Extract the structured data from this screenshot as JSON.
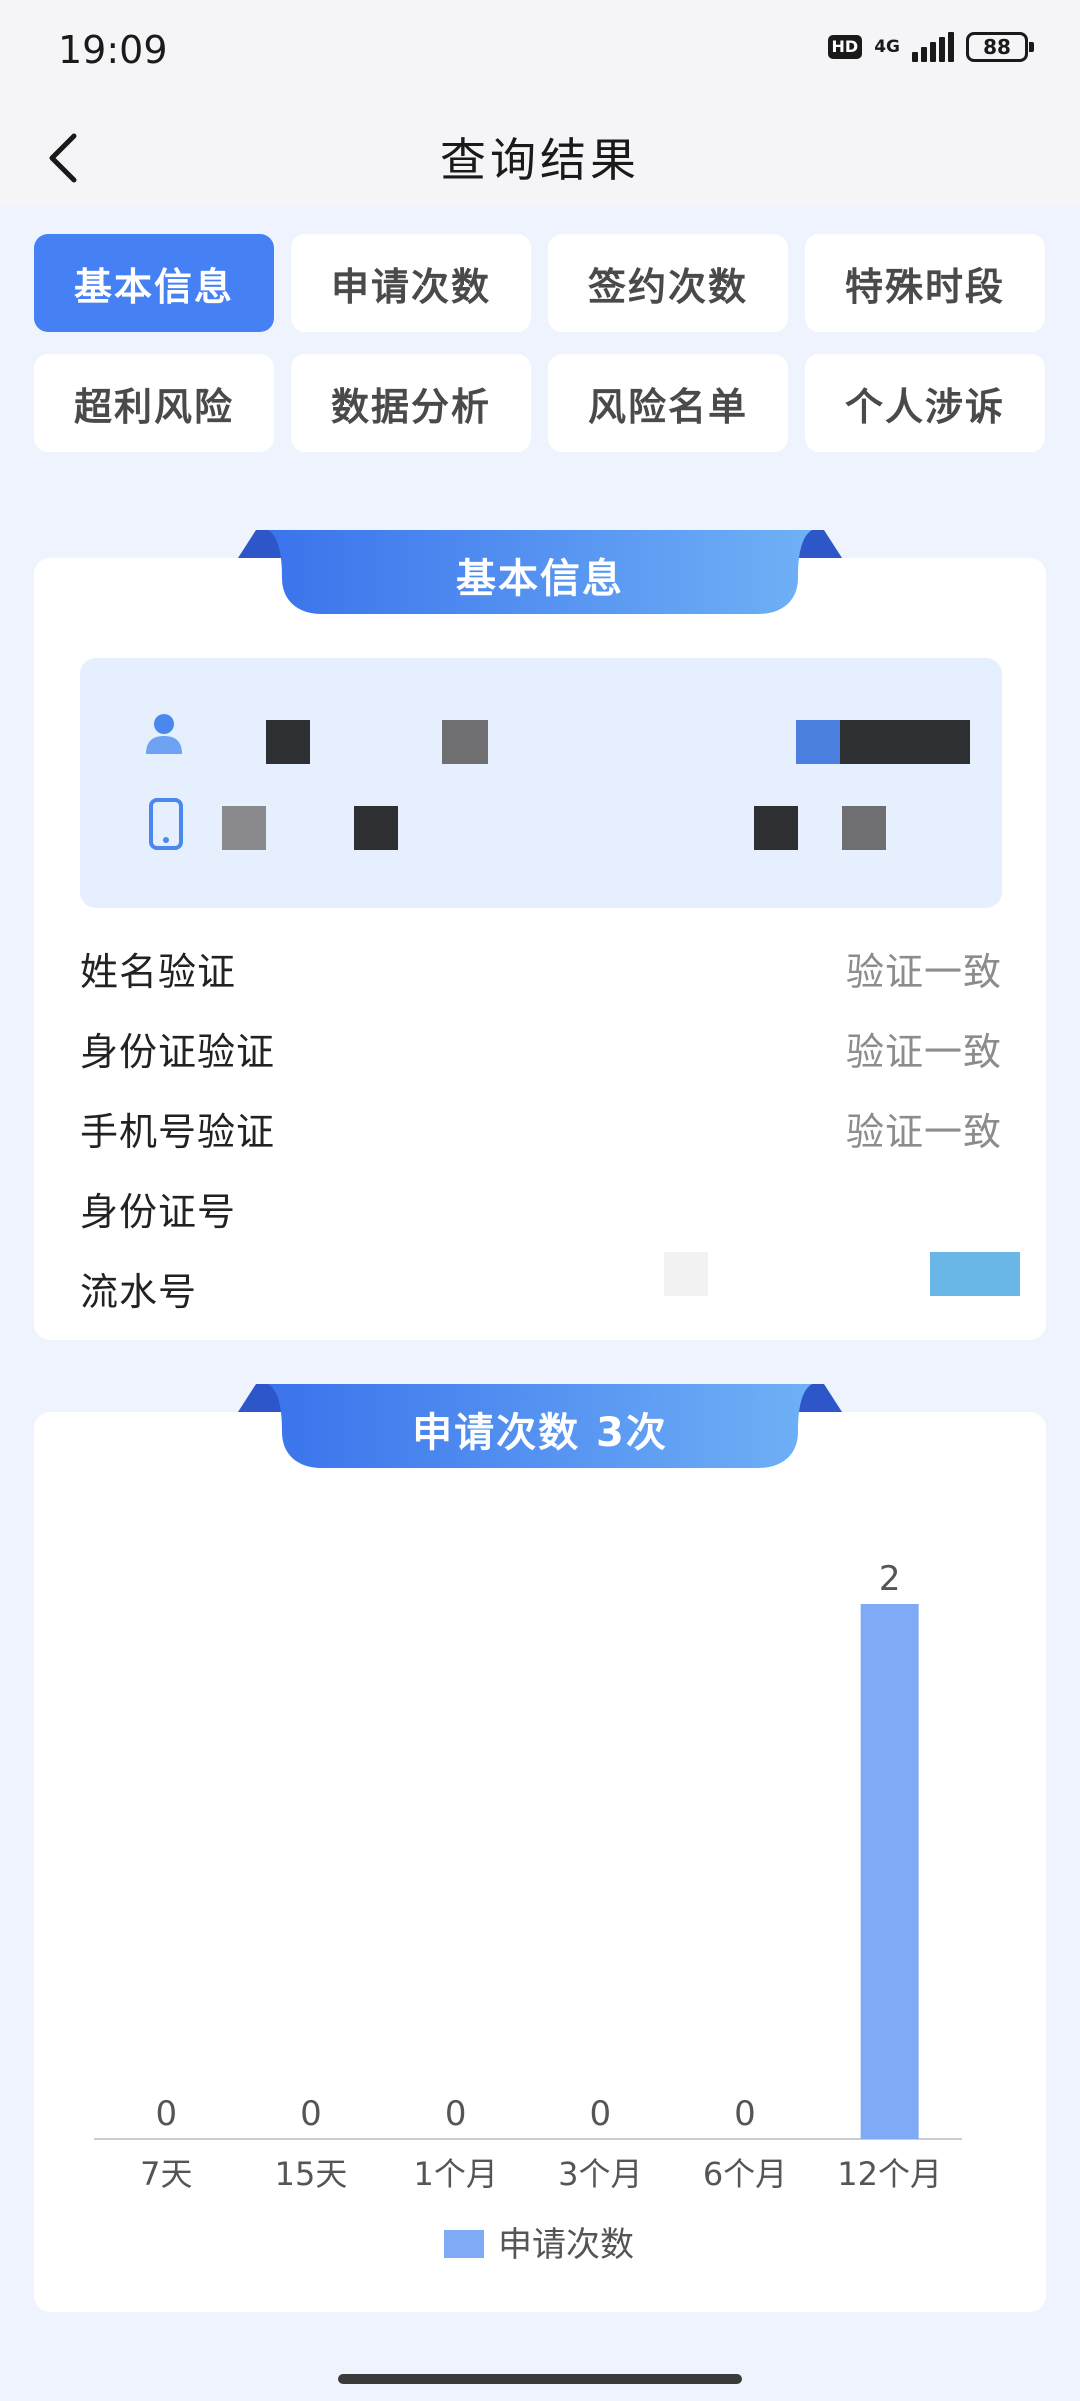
{
  "status_bar": {
    "time": "19:09",
    "hd": "HD",
    "network": "4G",
    "battery": "88"
  },
  "nav": {
    "title": "查询结果",
    "back_icon": "chevron-left-icon"
  },
  "tabs": [
    {
      "label": "基本信息",
      "active": true
    },
    {
      "label": "申请次数",
      "active": false
    },
    {
      "label": "签约次数",
      "active": false
    },
    {
      "label": "特殊时段",
      "active": false
    },
    {
      "label": "超利风险",
      "active": false
    },
    {
      "label": "数据分析",
      "active": false
    },
    {
      "label": "风险名单",
      "active": false
    },
    {
      "label": "个人涉诉",
      "active": false
    }
  ],
  "basic_info": {
    "title": "基本信息",
    "person_icon": "person-icon",
    "phone_icon": "phone-icon",
    "rows": [
      {
        "label": "姓名验证",
        "value": "验证一致"
      },
      {
        "label": "身份证验证",
        "value": "验证一致"
      },
      {
        "label": "手机号验证",
        "value": "验证一致"
      },
      {
        "label": "身份证号",
        "value": ""
      },
      {
        "label": "流水号",
        "value": ""
      }
    ]
  },
  "apply_count": {
    "title": "申请次数 3次"
  },
  "chart_data": {
    "type": "bar",
    "categories": [
      "7天",
      "15天",
      "1个月",
      "3个月",
      "6个月",
      "12个月"
    ],
    "series": [
      {
        "name": "申请次数",
        "values": [
          0,
          0,
          0,
          0,
          0,
          2
        ]
      }
    ],
    "ylim": [
      0,
      2
    ],
    "grid": false,
    "legend_position": "bottom-center",
    "bar_color": "#7faaf5"
  },
  "colors": {
    "accent": "#4580f5",
    "background": "#eef3fd",
    "bar": "#7faaf5"
  }
}
